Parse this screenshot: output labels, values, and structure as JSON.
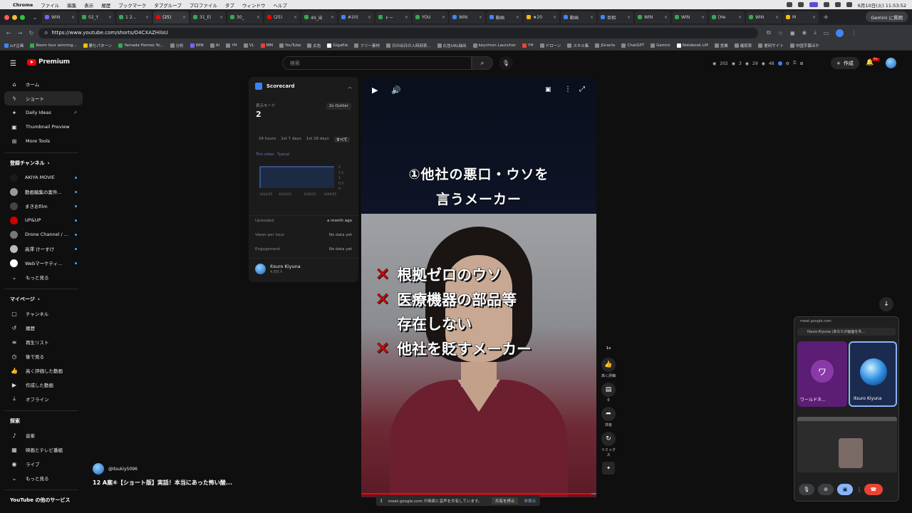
{
  "menubar": {
    "app": "Chrome",
    "items": [
      "ファイル",
      "編集",
      "表示",
      "履歴",
      "ブックマーク",
      "タブグループ",
      "プロファイル",
      "タブ",
      "ウィンドウ",
      "ヘルプ"
    ],
    "datetime": "6月10日(火) 11:53:52"
  },
  "tabs": [
    {
      "label": "WIN",
      "color": "#7b61ff"
    },
    {
      "label": "02_Y",
      "color": "#34a853"
    },
    {
      "label": "1 2...",
      "color": "#34a853"
    },
    {
      "label": "(25)",
      "color": "#ff0000",
      "active": true
    },
    {
      "label": "31_El",
      "color": "#34a853"
    },
    {
      "label": "30_",
      "color": "#34a853"
    },
    {
      "label": "(25)",
      "color": "#ff0000"
    },
    {
      "label": "49_出",
      "color": "#34a853"
    },
    {
      "label": "#20(",
      "color": "#4285f4"
    },
    {
      "label": "トー",
      "color": "#34a853"
    },
    {
      "label": "YOU",
      "color": "#34a853"
    },
    {
      "label": "WIN",
      "color": "#4285f4"
    },
    {
      "label": "動画",
      "color": "#4285f4"
    },
    {
      "label": "★20",
      "color": "#fbbc04"
    },
    {
      "label": "動画",
      "color": "#4285f4"
    },
    {
      "label": "否相",
      "color": "#4285f4"
    },
    {
      "label": "WIN",
      "color": "#34a853"
    },
    {
      "label": "WIN",
      "color": "#34a853"
    },
    {
      "label": "[He",
      "color": "#34a853"
    },
    {
      "label": "WIN",
      "color": "#34a853"
    },
    {
      "label": "M",
      "color": "#fbbc04"
    }
  ],
  "gemini_button": "Gemini に質問",
  "address": {
    "url": "https://www.youtube.com/shorts/O4CXAZHilsU"
  },
  "bookmarks": [
    {
      "label": "IoT企画",
      "color": "#4285f4"
    },
    {
      "label": "Room tour winning...",
      "color": "#34a853"
    },
    {
      "label": "勝ちパターン",
      "color": "#fbbc04"
    },
    {
      "label": "Yamada Homes Yo...",
      "color": "#34a853"
    },
    {
      "label": "分析",
      "color": "#888888"
    },
    {
      "label": "WIN",
      "color": "#7b61ff"
    },
    {
      "label": "AI",
      "color": "#888888"
    },
    {
      "label": "YH",
      "color": "#888888"
    },
    {
      "label": "VL",
      "color": "#888888"
    },
    {
      "label": "MM",
      "color": "#ea4335"
    },
    {
      "label": "YouTube",
      "color": "#888888"
    },
    {
      "label": "広告",
      "color": "#888888"
    },
    {
      "label": "Gigafile",
      "color": "#ffffff"
    },
    {
      "label": "フリー素材",
      "color": "#888888"
    },
    {
      "label": "日の出日の入時刻表...",
      "color": "#888888"
    },
    {
      "label": "広告URL抽出",
      "color": "#888888"
    },
    {
      "label": "keychron Launcher",
      "color": "#888888"
    },
    {
      "label": "YH",
      "color": "#ea4335"
    },
    {
      "label": "ドローン",
      "color": "#888888"
    },
    {
      "label": "スキル集",
      "color": "#888888"
    },
    {
      "label": "JGrants",
      "color": "#888888"
    },
    {
      "label": "ChatGPT",
      "color": "#888888"
    },
    {
      "label": "Gemini",
      "color": "#888888"
    },
    {
      "label": "Notebook LM",
      "color": "#ffffff"
    },
    {
      "label": "営業",
      "color": "#888888"
    },
    {
      "label": "確認表",
      "color": "#888888"
    },
    {
      "label": "便利サイト",
      "color": "#888888"
    },
    {
      "label": "中国字幕ほか",
      "color": "#888888"
    }
  ],
  "masthead": {
    "logo": "Premium",
    "search_placeholder": "検索",
    "stats": [
      "202",
      "3",
      "29",
      "48"
    ],
    "create_label": "作成",
    "notifications": "9+"
  },
  "sidebar": {
    "top": [
      {
        "label": "ホーム",
        "icon": "home-icon"
      },
      {
        "label": "ショート",
        "icon": "shorts-icon",
        "active": true
      },
      {
        "label": "Daily Ideas",
        "icon": "lightbulb-icon"
      },
      {
        "label": "Thumbnail Preview",
        "icon": "image-icon"
      },
      {
        "label": "More Tools",
        "icon": "grid-icon"
      }
    ],
    "subscriptions_header": "登録チャンネル",
    "subscriptions": [
      {
        "label": "AKIYA MOVIE",
        "color": "#1a1a1a"
      },
      {
        "label": "動画編集の案件...",
        "color": "#999999"
      },
      {
        "label": "まきおfilm",
        "color": "#444444"
      },
      {
        "label": "UP&UP",
        "color": "#cc0000"
      },
      {
        "label": "Drone Channel / ...",
        "color": "#777777"
      },
      {
        "label": "高澤 けーすけ",
        "color": "#bbbbbb"
      },
      {
        "label": "Webマーケティ...",
        "color": "#ffffff"
      }
    ],
    "show_more": "もっと見る",
    "you_header": "マイページ",
    "you": [
      {
        "label": "チャンネル",
        "icon": "channel-icon"
      },
      {
        "label": "履歴",
        "icon": "history-icon"
      },
      {
        "label": "再生リスト",
        "icon": "playlist-icon"
      },
      {
        "label": "後で見る",
        "icon": "clock-icon"
      },
      {
        "label": "高く評価した動画",
        "icon": "like-icon"
      },
      {
        "label": "作成した動画",
        "icon": "video-icon"
      },
      {
        "label": "オフライン",
        "icon": "download-icon"
      }
    ],
    "explore_header": "探索",
    "explore": [
      {
        "label": "音楽",
        "icon": "music-icon"
      },
      {
        "label": "映画とテレビ番組",
        "icon": "film-icon"
      },
      {
        "label": "ライブ",
        "icon": "live-icon"
      }
    ],
    "explore_more": "もっと見る",
    "footer": "YouTube の他のサービス"
  },
  "scorecard": {
    "title": "Scorecard",
    "mode_label": "表示モード",
    "mode_value": "2",
    "outlier": "2x Outlier",
    "ranges": [
      "24 hours",
      "1st 7 days",
      "1st 28 days",
      "すべて"
    ],
    "legend": "This video  ·  Typical",
    "chart_ticks_x": [
      "6/10/25",
      "6/03/25",
      "5/30/25",
      "6/09/25"
    ],
    "chart_ticks_y": [
      "2",
      "1.5",
      "1",
      "0.5",
      "0"
    ],
    "rows": [
      {
        "label": "Uploaded",
        "value": "a month ago"
      },
      {
        "label": "Views per hour",
        "value": "No data yet"
      },
      {
        "label": "Engagement",
        "value": "No data yet"
      }
    ],
    "channel_name": "Itsuro Kiyuna",
    "channel_subs": "4.9万人"
  },
  "player": {
    "caption_top_1": "①他社の悪口・ウソを",
    "caption_top_2": "言うメーカー",
    "lines": [
      {
        "mark": "✕",
        "text": "根拠ゼロのウソ"
      },
      {
        "mark": "✕",
        "text": "医療機器の部品等"
      },
      {
        "mark": "",
        "text": "存在しない"
      },
      {
        "mark": "✕",
        "text": "他社を貶すメーカー"
      }
    ],
    "progress": 0.98
  },
  "rail": {
    "speed": "1x",
    "like_label": "高く評価",
    "comments_count": "0",
    "share_label": "共有",
    "remix_label": "リミックス"
  },
  "video": {
    "handle": "@itsukiy5096",
    "title": "12 A案⑥【ショート版】実話！本当にあった怖い酸..."
  },
  "share_banner": {
    "text": "meet.google.com が画面と音声を共有しています。",
    "stop": "共有を停止",
    "hide": "非表示"
  },
  "meet": {
    "domain": "meet.google.com",
    "presenter": "Itsuro Kiyuna (あなたが画面を共...",
    "tile1_initial": "ワ",
    "tile1_name": "ワールドネ...",
    "tile2_name": "Itsuro Kiyuna"
  }
}
